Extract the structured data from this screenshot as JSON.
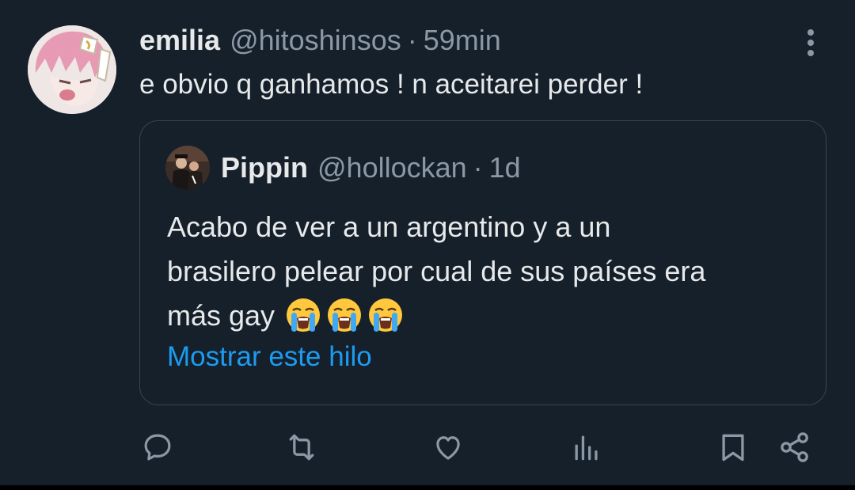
{
  "tweet": {
    "author": {
      "display_name": "emilia",
      "handle": "@hitoshinsos"
    },
    "separator": "·",
    "time": "59min",
    "text": "e obvio q ganhamos ! n aceitarei perder !",
    "more_icon": "more-vertical-icon"
  },
  "quoted_tweet": {
    "author": {
      "display_name": "Pippin",
      "handle": "@hollockan"
    },
    "separator": "·",
    "time": "1d",
    "text_lines": [
      "Acabo de ver a un argentino y a un",
      "brasilero pelear por cual de sus países era",
      "más gay"
    ],
    "emojis": [
      "loudly-crying-face",
      "loudly-crying-face",
      "loudly-crying-face"
    ],
    "show_thread_label": "Mostrar este hilo"
  },
  "actions": [
    {
      "icon": "reply-icon"
    },
    {
      "icon": "retweet-icon"
    },
    {
      "icon": "like-icon"
    },
    {
      "icon": "views-icon"
    },
    {
      "icon": "bookmark-icon"
    },
    {
      "icon": "share-icon"
    }
  ],
  "colors": {
    "background": "#15202b",
    "text_primary": "#e7e9ea",
    "text_secondary": "#8b98a5",
    "link": "#1d9bf0",
    "border": "#38444d"
  }
}
